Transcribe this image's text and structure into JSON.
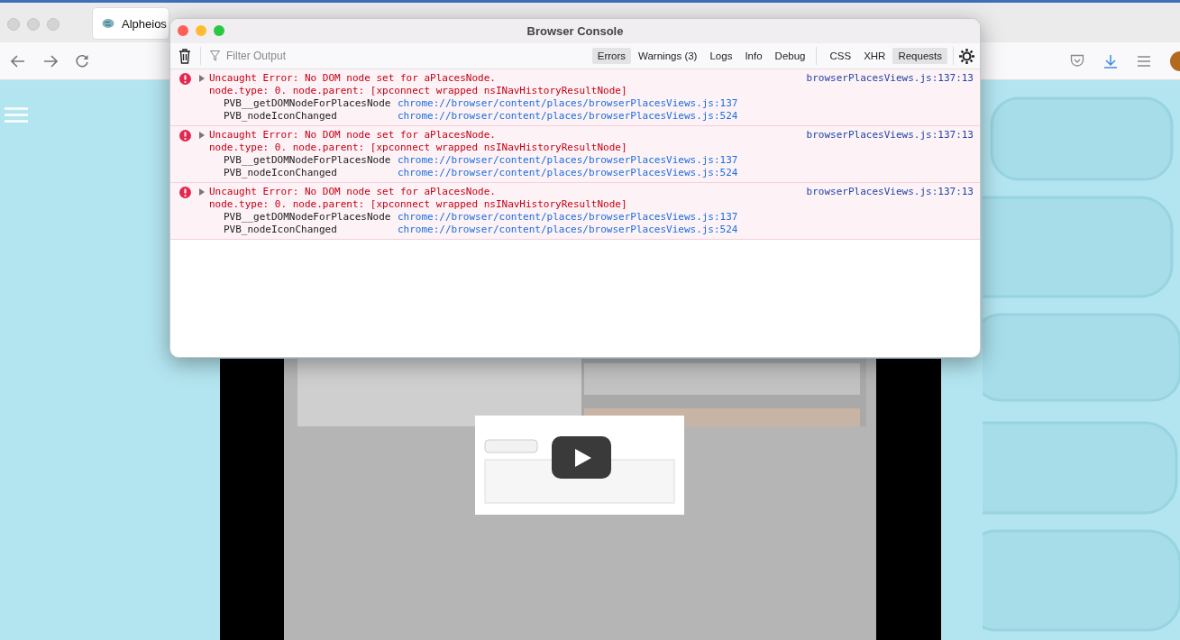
{
  "browser": {
    "tab": {
      "title": "Alpheios",
      "selected": true
    }
  },
  "console": {
    "title": "Browser Console",
    "filter": {
      "placeholder": "Filter Output"
    },
    "level_filters": [
      {
        "label": "Errors",
        "selected": true
      },
      {
        "label": "Warnings (3)",
        "selected": false
      },
      {
        "label": "Logs",
        "selected": false
      },
      {
        "label": "Info",
        "selected": false
      },
      {
        "label": "Debug",
        "selected": false
      }
    ],
    "type_filters": [
      {
        "label": "CSS",
        "selected": false
      },
      {
        "label": "XHR",
        "selected": false
      },
      {
        "label": "Requests",
        "selected": true
      }
    ],
    "messages": [
      {
        "kind": "error",
        "expanded": false,
        "message": "Uncaught Error: No DOM node set for aPlacesNode.",
        "detail": "node.type: 0. node.parent: [xpconnect wrapped nsINavHistoryResultNode]",
        "location": "browserPlacesViews.js:137:13",
        "frames": [
          {
            "function": "PVB__getDOMNodeForPlacesNode",
            "source": "chrome://browser/content/places/browserPlacesViews.js:137"
          },
          {
            "function": "PVB_nodeIconChanged",
            "source": "chrome://browser/content/places/browserPlacesViews.js:524"
          }
        ]
      },
      {
        "kind": "error",
        "expanded": false,
        "message": "Uncaught Error: No DOM node set for aPlacesNode.",
        "detail": "node.type: 0. node.parent: [xpconnect wrapped nsINavHistoryResultNode]",
        "location": "browserPlacesViews.js:137:13",
        "frames": [
          {
            "function": "PVB__getDOMNodeForPlacesNode",
            "source": "chrome://browser/content/places/browserPlacesViews.js:137"
          },
          {
            "function": "PVB_nodeIconChanged",
            "source": "chrome://browser/content/places/browserPlacesViews.js:524"
          }
        ]
      },
      {
        "kind": "error",
        "expanded": false,
        "message": "Uncaught Error: No DOM node set for aPlacesNode.",
        "detail": "node.type: 0. node.parent: [xpconnect wrapped nsINavHistoryResultNode]",
        "location": "browserPlacesViews.js:137:13",
        "frames": [
          {
            "function": "PVB__getDOMNodeForPlacesNode",
            "source": "chrome://browser/content/places/browserPlacesViews.js:137"
          },
          {
            "function": "PVB_nodeIconChanged",
            "source": "chrome://browser/content/places/browserPlacesViews.js:524"
          }
        ]
      }
    ]
  }
}
